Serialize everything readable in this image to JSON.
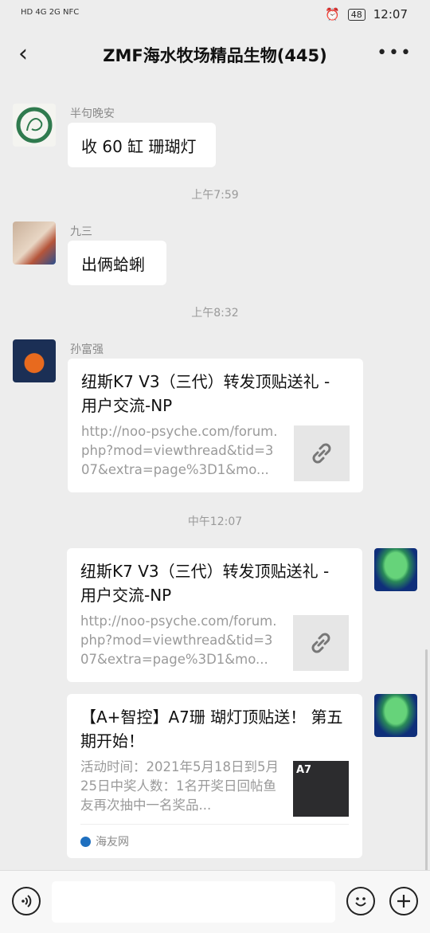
{
  "status": {
    "left": "HD 4G 2G NFC",
    "time": "12:07",
    "battery": "48"
  },
  "header": {
    "title": "ZMF海水牧场精品生物(445)"
  },
  "messages": {
    "m1": {
      "sender": "半句晚安",
      "text": "收 60 缸 珊瑚灯"
    },
    "t1": "上午7:59",
    "m2": {
      "sender": "九三",
      "text": "出俩蛤蜊"
    },
    "t2": "上午8:32",
    "m3": {
      "sender": "孙富强",
      "title": "纽斯K7 V3（三代）转发顶贴送礼 - 用户交流-NP",
      "desc": "http://noo-psyche.com/forum.php?mod=viewthread&tid=307&extra=page%3D1&mo..."
    },
    "t3": "中午12:07",
    "m4": {
      "title": "纽斯K7 V3（三代）转发顶贴送礼 - 用户交流-NP",
      "desc": "http://noo-psyche.com/forum.php?mod=viewthread&tid=307&extra=page%3D1&mo..."
    },
    "m5": {
      "title": "【A+智控】A7珊 瑚灯顶贴送！ 第五期开始！",
      "desc": "活动时间：2021年5月18日到5月25日中奖人数：1名开奖日回帖鱼友再次抽中一名奖品...",
      "thumb_label": "A7",
      "source": "海友网"
    }
  },
  "icons": {
    "back": "back-chevron-icon",
    "more": "more-dots-icon",
    "link": "link-icon",
    "voice": "voice-icon",
    "emoji": "emoji-icon",
    "plus": "plus-icon"
  },
  "colors": {
    "background": "#ededed",
    "bubble": "#ffffff",
    "meta_text": "#9a9a9a"
  }
}
